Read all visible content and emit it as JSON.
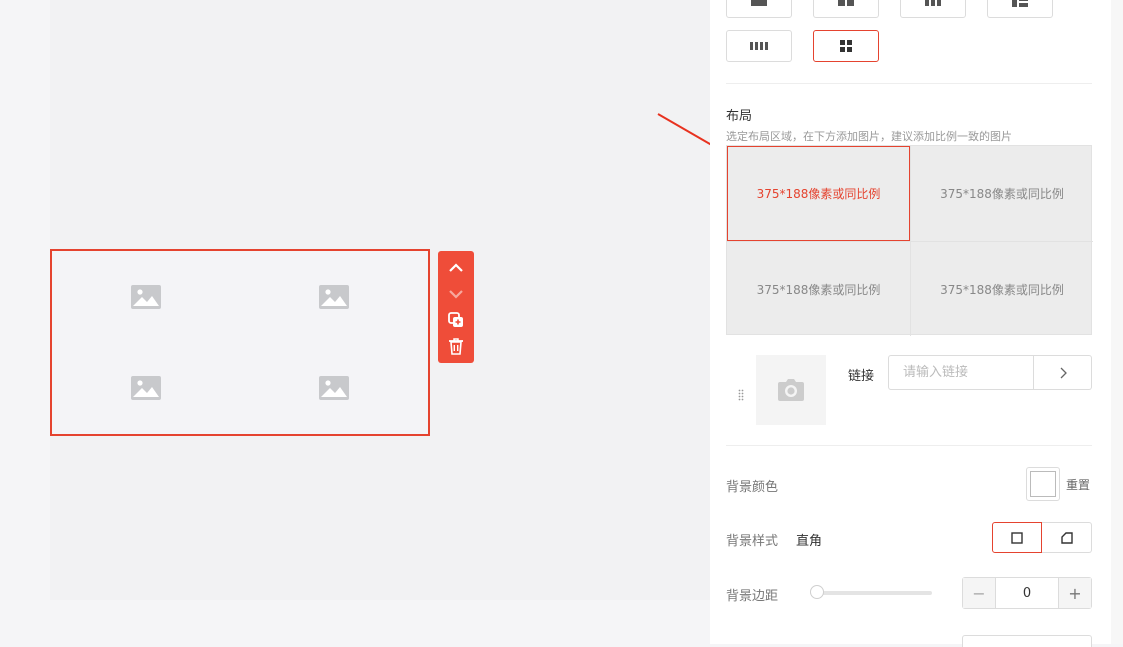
{
  "canvas": {
    "cells": [
      {
        "icon": "image-placeholder-icon"
      },
      {
        "icon": "image-placeholder-icon"
      },
      {
        "icon": "image-placeholder-icon"
      },
      {
        "icon": "image-placeholder-icon"
      }
    ],
    "toolbar": [
      "move-up-icon",
      "move-down-icon",
      "copy-icon",
      "delete-icon"
    ]
  },
  "panel": {
    "layout_section": {
      "title": "布局",
      "description": "选定布局区域，在下方添加图片，建议添加比例一致的图片",
      "cells": [
        "375*188像素或同比例",
        "375*188像素或同比例",
        "375*188像素或同比例",
        "375*188像素或同比例"
      ]
    },
    "link": {
      "label": "链接",
      "placeholder": "请输入链接"
    },
    "background_color": {
      "label": "背景颜色",
      "reset": "重置"
    },
    "background_style": {
      "label": "背景样式",
      "value": "直角"
    },
    "background_margin": {
      "label": "背景边距",
      "value": "0"
    }
  },
  "colors": {
    "accent": "#e5432f",
    "toolbar": "#ef4d39"
  }
}
